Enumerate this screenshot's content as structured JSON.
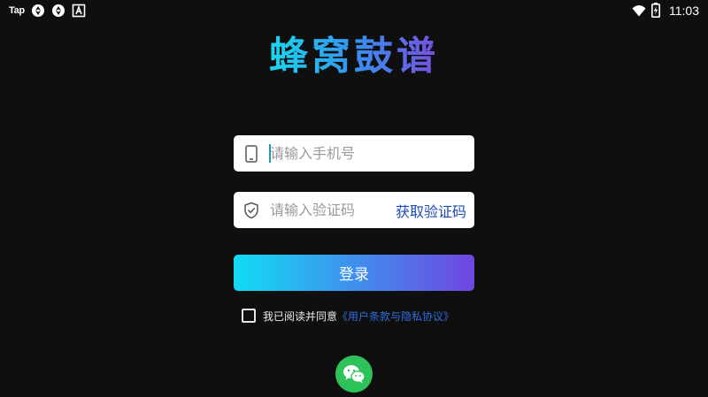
{
  "status_bar": {
    "app_label": "Tap",
    "time": "11:03",
    "icons": [
      "tap-app-icon",
      "sync-icon",
      "sync-icon",
      "font-app-icon",
      "wifi-icon",
      "battery-charging-icon"
    ]
  },
  "app": {
    "title": "蜂窝鼓谱"
  },
  "form": {
    "phone": {
      "placeholder": "请输入手机号",
      "value": "",
      "icon": "phone-icon"
    },
    "code": {
      "placeholder": "请输入验证码",
      "value": "",
      "icon": "shield-icon",
      "get_code_label": "获取验证码"
    },
    "login_label": "登录"
  },
  "agreement": {
    "checked": false,
    "text": "我已阅读并同意",
    "link": "《用户条款与隐私协议》"
  },
  "social": {
    "wechat_icon": "wechat-icon"
  },
  "colors": {
    "background": "#0f0f0f",
    "accent_start": "#12dcf2",
    "accent_end": "#7046e0",
    "link": "#2f6ee0",
    "wechat": "#2fc25b"
  }
}
